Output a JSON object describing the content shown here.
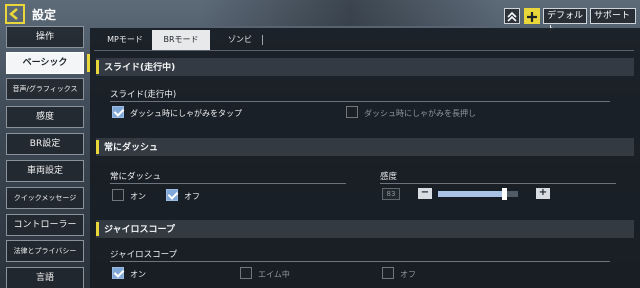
{
  "header": {
    "title": "設定",
    "default_label": "デフォルト",
    "support_label": "サポート"
  },
  "sidebar": {
    "items": [
      {
        "label": "操作"
      },
      {
        "label": "ベーシック"
      },
      {
        "label": "音声/グラフィックス"
      },
      {
        "label": "感度"
      },
      {
        "label": "BR設定"
      },
      {
        "label": "車両設定"
      },
      {
        "label": "クイックメッセージ"
      },
      {
        "label": "コントローラー"
      },
      {
        "label": "法律とプライバシー"
      },
      {
        "label": "言語"
      }
    ],
    "active_index": 1
  },
  "tabs": [
    {
      "label": "MPモード"
    },
    {
      "label": "BRモード"
    },
    {
      "label": "ゾンビ"
    }
  ],
  "active_tab": 1,
  "sections": {
    "slide": {
      "header": "スライド(走行中)",
      "sub_label": "スライド(走行中)",
      "options": [
        {
          "label": "ダッシュ時にしゃがみをタップ",
          "checked": true
        },
        {
          "label": "ダッシュ時にしゃがみを長押し",
          "checked": false
        }
      ]
    },
    "dash": {
      "header": "常にダッシュ",
      "sub_label": "常にダッシュ",
      "options": [
        {
          "label": "オン",
          "checked": false
        },
        {
          "label": "オフ",
          "checked": true
        }
      ],
      "sensitivity_label": "感度",
      "sensitivity_value": "83",
      "minus": "−",
      "plus": "+",
      "slider_percent": 83
    },
    "gyro": {
      "header": "ジャイロスコープ",
      "sub_label": "ジャイロスコープ",
      "options": [
        {
          "label": "オン",
          "checked": true
        },
        {
          "label": "エイム中",
          "checked": false
        },
        {
          "label": "オフ",
          "checked": false
        }
      ]
    }
  },
  "colors": {
    "accent": "#e8d63a",
    "checkbox_on": "#7fa7d7",
    "panel": "#181d23"
  }
}
